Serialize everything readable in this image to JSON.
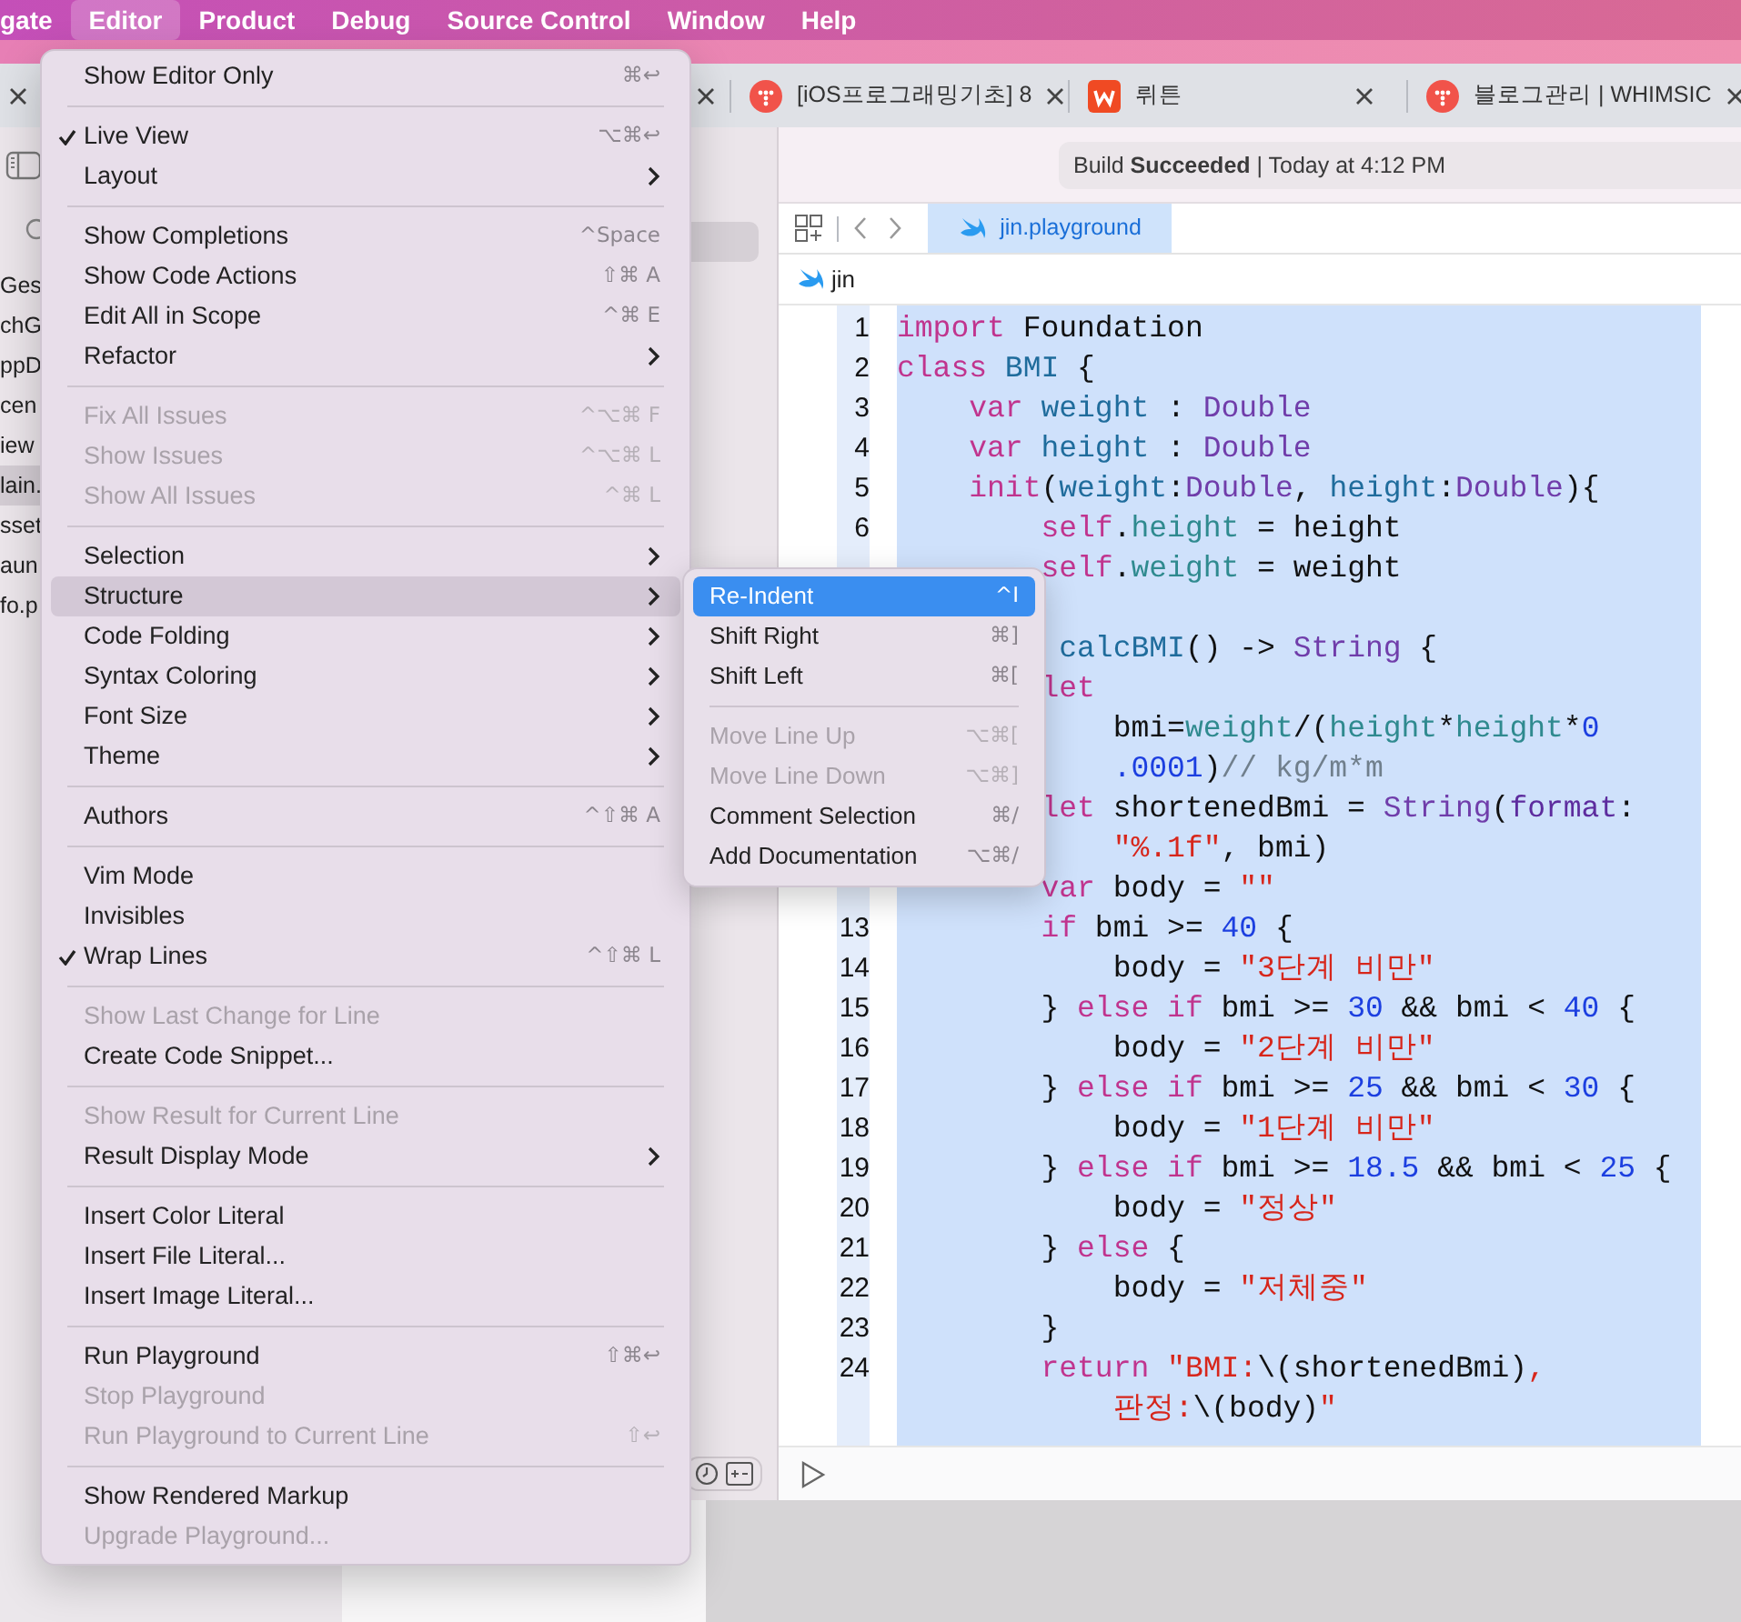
{
  "menu_bar": [
    {
      "label": "gate",
      "selected": false
    },
    {
      "label": "Editor",
      "selected": true
    },
    {
      "label": "Product",
      "selected": false
    },
    {
      "label": "Debug",
      "selected": false
    },
    {
      "label": "Source Control",
      "selected": false
    },
    {
      "label": "Window",
      "selected": false
    },
    {
      "label": "Help",
      "selected": false
    }
  ],
  "browser_tabs": [
    {
      "title": "[iOS프로그래밍기초] 8",
      "kind": "dots"
    },
    {
      "title": "뤼튼",
      "kind": "square"
    },
    {
      "title": "블로그관리 | WHIMSIC",
      "kind": "dots"
    }
  ],
  "navigator": {
    "files": [
      {
        "name": "Ges",
        "selected": false
      },
      {
        "name": "chG",
        "selected": false
      },
      {
        "name": "ppD",
        "selected": false
      },
      {
        "name": "cen",
        "selected": false
      },
      {
        "name": "iew",
        "selected": false
      },
      {
        "name": "lain.",
        "selected": true
      },
      {
        "name": "sset",
        "selected": false
      },
      {
        "name": "aun",
        "selected": false
      },
      {
        "name": "fo.p",
        "selected": false
      }
    ]
  },
  "status": "Build **Succeeded** | Today at 4:12 PM",
  "editor_tabs": [
    {
      "label": "jin.playground",
      "selected": true
    }
  ],
  "jump_bar": {
    "label": "jin"
  },
  "code": [
    {
      "kind": "line",
      "number": "1",
      "t": [
        {
          "text": "import",
          "kind": "keyword"
        },
        {
          "text": " Foundation",
          "kind": "plain"
        }
      ]
    },
    {
      "kind": "line",
      "number": "2",
      "t": [
        {
          "text": "class",
          "kind": "keyword"
        },
        {
          "text": " BMI",
          "kind": "declaration"
        },
        {
          "text": " {",
          "kind": "plain"
        }
      ]
    },
    {
      "kind": "line",
      "number": "3",
      "t": [
        {
          "text": "    var",
          "kind": "keyword"
        },
        {
          "text": " weight",
          "kind": "declaration"
        },
        {
          "text": " : ",
          "kind": "plain"
        },
        {
          "text": "Double",
          "kind": "type"
        }
      ]
    },
    {
      "kind": "line",
      "number": "4",
      "t": [
        {
          "text": "    var",
          "kind": "keyword"
        },
        {
          "text": " height",
          "kind": "declaration"
        },
        {
          "text": " : ",
          "kind": "plain"
        },
        {
          "text": "Double",
          "kind": "type"
        }
      ]
    },
    {
      "kind": "line",
      "number": "5",
      "t": [
        {
          "text": "    init",
          "kind": "keyword"
        },
        {
          "text": "(",
          "kind": "plain"
        },
        {
          "text": "weight",
          "kind": "declaration"
        },
        {
          "text": ":",
          "kind": "plain"
        },
        {
          "text": "Double",
          "kind": "type"
        },
        {
          "text": ", ",
          "kind": "plain"
        },
        {
          "text": "height",
          "kind": "declaration"
        },
        {
          "text": ":",
          "kind": "plain"
        },
        {
          "text": "Double",
          "kind": "type"
        },
        {
          "text": "){",
          "kind": "plain"
        }
      ]
    },
    {
      "kind": "line",
      "number": "6",
      "t": [
        {
          "text": "        self",
          "kind": "keyword"
        },
        {
          "text": ".",
          "kind": "plain"
        },
        {
          "text": "height",
          "kind": "property"
        },
        {
          "text": " = height",
          "kind": "plain"
        }
      ]
    },
    {
      "kind": "line",
      "t": [
        {
          "text": "        self",
          "kind": "keyword"
        },
        {
          "text": ".",
          "kind": "plain"
        },
        {
          "text": "weight",
          "kind": "property"
        },
        {
          "text": " = weight",
          "kind": "plain"
        }
      ]
    },
    {
      "kind": "covered"
    },
    {
      "kind": "line",
      "t": [
        {
          "text": "         calcBMI",
          "kind": "declaration"
        },
        {
          "text": "() -> ",
          "kind": "plain"
        },
        {
          "text": "String",
          "kind": "type"
        },
        {
          "text": " {",
          "kind": "plain"
        }
      ]
    },
    {
      "kind": "line",
      "t": [
        {
          "text": "        let",
          "kind": "keyword"
        }
      ]
    },
    {
      "kind": "line",
      "t": [
        {
          "text": "            bmi=",
          "kind": "plain"
        },
        {
          "text": "weight",
          "kind": "property"
        },
        {
          "text": "/(",
          "kind": "plain"
        },
        {
          "text": "height",
          "kind": "property"
        },
        {
          "text": "*",
          "kind": "plain"
        },
        {
          "text": "height",
          "kind": "property"
        },
        {
          "text": "*",
          "kind": "plain"
        },
        {
          "text": "0",
          "kind": "number"
        }
      ]
    },
    {
      "kind": "line",
      "t": [
        {
          "text": "            .0001",
          "kind": "number"
        },
        {
          "text": ")",
          "kind": "plain"
        },
        {
          "text": "// kg/m*m",
          "kind": "comment"
        }
      ]
    },
    {
      "kind": "line",
      "t": [
        {
          "text": "        let",
          "kind": "keyword"
        },
        {
          "text": " shortenedBmi = ",
          "kind": "plain"
        },
        {
          "text": "String",
          "kind": "type"
        },
        {
          "text": "(",
          "kind": "plain"
        },
        {
          "text": "format",
          "kind": "parameter"
        },
        {
          "text": ":",
          "kind": "plain"
        }
      ]
    },
    {
      "kind": "line",
      "t": [
        {
          "text": "            \"%.1f\"",
          "kind": "string"
        },
        {
          "text": ", bmi)",
          "kind": "plain"
        }
      ]
    },
    {
      "kind": "line",
      "t": [
        {
          "text": "        var",
          "kind": "keyword"
        },
        {
          "text": " body = ",
          "kind": "plain"
        },
        {
          "text": "\"\"",
          "kind": "string"
        }
      ]
    },
    {
      "kind": "line",
      "number": "13",
      "t": [
        {
          "text": "        if",
          "kind": "keyword"
        },
        {
          "text": " bmi >= ",
          "kind": "plain"
        },
        {
          "text": "40",
          "kind": "number"
        },
        {
          "text": " {",
          "kind": "plain"
        }
      ]
    },
    {
      "kind": "line",
      "number": "14",
      "t": [
        {
          "text": "            body = ",
          "kind": "plain"
        },
        {
          "text": "\"3단계 비만\"",
          "kind": "string"
        }
      ]
    },
    {
      "kind": "line",
      "number": "15",
      "t": [
        {
          "text": "        } ",
          "kind": "plain"
        },
        {
          "text": "else if",
          "kind": "keyword"
        },
        {
          "text": " bmi >= ",
          "kind": "plain"
        },
        {
          "text": "30",
          "kind": "number"
        },
        {
          "text": " && bmi < ",
          "kind": "plain"
        },
        {
          "text": "40",
          "kind": "number"
        },
        {
          "text": " {",
          "kind": "plain"
        }
      ]
    },
    {
      "kind": "line",
      "number": "16",
      "t": [
        {
          "text": "            body = ",
          "kind": "plain"
        },
        {
          "text": "\"2단계 비만\"",
          "kind": "string"
        }
      ]
    },
    {
      "kind": "line",
      "number": "17",
      "t": [
        {
          "text": "        } ",
          "kind": "plain"
        },
        {
          "text": "else if",
          "kind": "keyword"
        },
        {
          "text": " bmi >= ",
          "kind": "plain"
        },
        {
          "text": "25",
          "kind": "number"
        },
        {
          "text": " && bmi < ",
          "kind": "plain"
        },
        {
          "text": "30",
          "kind": "number"
        },
        {
          "text": " {",
          "kind": "plain"
        }
      ]
    },
    {
      "kind": "line",
      "number": "18",
      "t": [
        {
          "text": "            body = ",
          "kind": "plain"
        },
        {
          "text": "\"1단계 비만\"",
          "kind": "string"
        }
      ]
    },
    {
      "kind": "line",
      "number": "19",
      "t": [
        {
          "text": "        } ",
          "kind": "plain"
        },
        {
          "text": "else if",
          "kind": "keyword"
        },
        {
          "text": " bmi >= ",
          "kind": "plain"
        },
        {
          "text": "18.5",
          "kind": "number"
        },
        {
          "text": " && bmi < ",
          "kind": "plain"
        },
        {
          "text": "25",
          "kind": "number"
        },
        {
          "text": " {",
          "kind": "plain"
        }
      ]
    },
    {
      "kind": "line",
      "number": "20",
      "t": [
        {
          "text": "            body = ",
          "kind": "plain"
        },
        {
          "text": "\"정상\"",
          "kind": "string"
        }
      ]
    },
    {
      "kind": "line",
      "number": "21",
      "t": [
        {
          "text": "        } ",
          "kind": "plain"
        },
        {
          "text": "else",
          "kind": "keyword"
        },
        {
          "text": " {",
          "kind": "plain"
        }
      ]
    },
    {
      "kind": "line",
      "number": "22",
      "t": [
        {
          "text": "            body = ",
          "kind": "plain"
        },
        {
          "text": "\"저체중\"",
          "kind": "string"
        }
      ]
    },
    {
      "kind": "line",
      "number": "23",
      "t": [
        {
          "text": "        }",
          "kind": "plain"
        }
      ]
    },
    {
      "kind": "line",
      "number": "24",
      "t": [
        {
          "text": "        return",
          "kind": "keyword"
        },
        {
          "text": " \"BMI:",
          "kind": "string"
        },
        {
          "text": "\\(shortenedBmi)",
          "kind": "plain"
        },
        {
          "text": ",",
          "kind": "string"
        }
      ]
    },
    {
      "kind": "line",
      "t": [
        {
          "text": "            판정:",
          "kind": "string"
        },
        {
          "text": "\\(body)",
          "kind": "plain"
        },
        {
          "text": "\"",
          "kind": "string"
        }
      ]
    }
  ],
  "editor_menu": [
    {
      "kind": "item",
      "label": "Show Editor Only",
      "shortcut": "⌘↩",
      "checked": false,
      "disabled": false,
      "selected": false,
      "submenu": false
    },
    {
      "kind": "separator"
    },
    {
      "kind": "item",
      "label": "Live View",
      "shortcut": "⌥⌘↩",
      "checked": true,
      "disabled": false,
      "selected": false,
      "submenu": false
    },
    {
      "kind": "item",
      "label": "Layout",
      "checked": false,
      "disabled": false,
      "selected": false,
      "submenu": true
    },
    {
      "kind": "separator"
    },
    {
      "kind": "item",
      "label": "Show Completions",
      "shortcut": "^Space",
      "checked": false,
      "disabled": false,
      "selected": false,
      "submenu": false
    },
    {
      "kind": "item",
      "label": "Show Code Actions",
      "shortcut": "⇧⌘ A",
      "checked": false,
      "disabled": false,
      "selected": false,
      "submenu": false
    },
    {
      "kind": "item",
      "label": "Edit All in Scope",
      "shortcut": "^⌘ E",
      "checked": false,
      "disabled": false,
      "selected": false,
      "submenu": false
    },
    {
      "kind": "item",
      "label": "Refactor",
      "checked": false,
      "disabled": false,
      "selected": false,
      "submenu": true
    },
    {
      "kind": "separator"
    },
    {
      "kind": "item",
      "label": "Fix All Issues",
      "shortcut": "^⌥⌘ F",
      "checked": false,
      "disabled": true,
      "selected": false,
      "submenu": false
    },
    {
      "kind": "item",
      "label": "Show Issues",
      "shortcut": "^⌥⌘ L",
      "checked": false,
      "disabled": true,
      "selected": false,
      "submenu": false
    },
    {
      "kind": "item",
      "label": "Show All Issues",
      "shortcut": "^⌘ L",
      "checked": false,
      "disabled": true,
      "selected": false,
      "submenu": false
    },
    {
      "kind": "separator"
    },
    {
      "kind": "item",
      "label": "Selection",
      "checked": false,
      "disabled": false,
      "selected": false,
      "submenu": true
    },
    {
      "kind": "item",
      "label": "Structure",
      "checked": false,
      "disabled": false,
      "selected": true,
      "submenu": true
    },
    {
      "kind": "item",
      "label": "Code Folding",
      "checked": false,
      "disabled": false,
      "selected": false,
      "submenu": true
    },
    {
      "kind": "item",
      "label": "Syntax Coloring",
      "checked": false,
      "disabled": false,
      "selected": false,
      "submenu": true
    },
    {
      "kind": "item",
      "label": "Font Size",
      "checked": false,
      "disabled": false,
      "selected": false,
      "submenu": true
    },
    {
      "kind": "item",
      "label": "Theme",
      "checked": false,
      "disabled": false,
      "selected": false,
      "submenu": true
    },
    {
      "kind": "separator"
    },
    {
      "kind": "item",
      "label": "Authors",
      "shortcut": "^⇧⌘ A",
      "checked": false,
      "disabled": false,
      "selected": false,
      "submenu": false
    },
    {
      "kind": "separator"
    },
    {
      "kind": "item",
      "label": "Vim Mode",
      "checked": false,
      "disabled": false,
      "selected": false,
      "submenu": false
    },
    {
      "kind": "item",
      "label": "Invisibles",
      "checked": false,
      "disabled": false,
      "selected": false,
      "submenu": false
    },
    {
      "kind": "item",
      "label": "Wrap Lines",
      "shortcut": "^⇧⌘ L",
      "checked": true,
      "disabled": false,
      "selected": false,
      "submenu": false
    },
    {
      "kind": "separator"
    },
    {
      "kind": "item",
      "label": "Show Last Change for Line",
      "checked": false,
      "disabled": true,
      "selected": false,
      "submenu": false
    },
    {
      "kind": "item",
      "label": "Create Code Snippet...",
      "checked": false,
      "disabled": false,
      "selected": false,
      "submenu": false
    },
    {
      "kind": "separator"
    },
    {
      "kind": "item",
      "label": "Show Result for Current Line",
      "checked": false,
      "disabled": true,
      "selected": false,
      "submenu": false
    },
    {
      "kind": "item",
      "label": "Result Display Mode",
      "checked": false,
      "disabled": false,
      "selected": false,
      "submenu": true
    },
    {
      "kind": "separator"
    },
    {
      "kind": "item",
      "label": "Insert Color Literal",
      "checked": false,
      "disabled": false,
      "selected": false,
      "submenu": false
    },
    {
      "kind": "item",
      "label": "Insert File Literal...",
      "checked": false,
      "disabled": false,
      "selected": false,
      "submenu": false
    },
    {
      "kind": "item",
      "label": "Insert Image Literal...",
      "checked": false,
      "disabled": false,
      "selected": false,
      "submenu": false
    },
    {
      "kind": "separator"
    },
    {
      "kind": "item",
      "label": "Run Playground",
      "shortcut": "⇧⌘↩",
      "checked": false,
      "disabled": false,
      "selected": false,
      "submenu": false
    },
    {
      "kind": "item",
      "label": "Stop Playground",
      "checked": false,
      "disabled": true,
      "selected": false,
      "submenu": false
    },
    {
      "kind": "item",
      "label": "Run Playground to Current Line",
      "shortcut": "⇧↩",
      "checked": false,
      "disabled": true,
      "selected": false,
      "submenu": false
    },
    {
      "kind": "separator"
    },
    {
      "kind": "item",
      "label": "Show Rendered Markup",
      "checked": false,
      "disabled": false,
      "selected": false,
      "submenu": false
    },
    {
      "kind": "item",
      "label": "Upgrade Playground...",
      "checked": false,
      "disabled": true,
      "selected": false,
      "submenu": false
    }
  ],
  "structure_submenu": [
    {
      "kind": "item",
      "label": "Re-Indent",
      "shortcut": "^I",
      "disabled": false,
      "selected": true
    },
    {
      "kind": "item",
      "label": "Shift Right",
      "shortcut": "⌘]",
      "disabled": false,
      "selected": false
    },
    {
      "kind": "item",
      "label": "Shift Left",
      "shortcut": "⌘[",
      "disabled": false,
      "selected": false
    },
    {
      "kind": "separator"
    },
    {
      "kind": "item",
      "label": "Move Line Up",
      "shortcut": "⌥⌘[",
      "disabled": true,
      "selected": false
    },
    {
      "kind": "item",
      "label": "Move Line Down",
      "shortcut": "⌥⌘]",
      "disabled": true,
      "selected": false
    },
    {
      "kind": "item",
      "label": "Comment Selection",
      "shortcut": "⌘/",
      "disabled": false,
      "selected": false
    },
    {
      "kind": "item",
      "label": "Add Documentation",
      "shortcut": "⌥⌘/",
      "disabled": false,
      "selected": false
    }
  ]
}
